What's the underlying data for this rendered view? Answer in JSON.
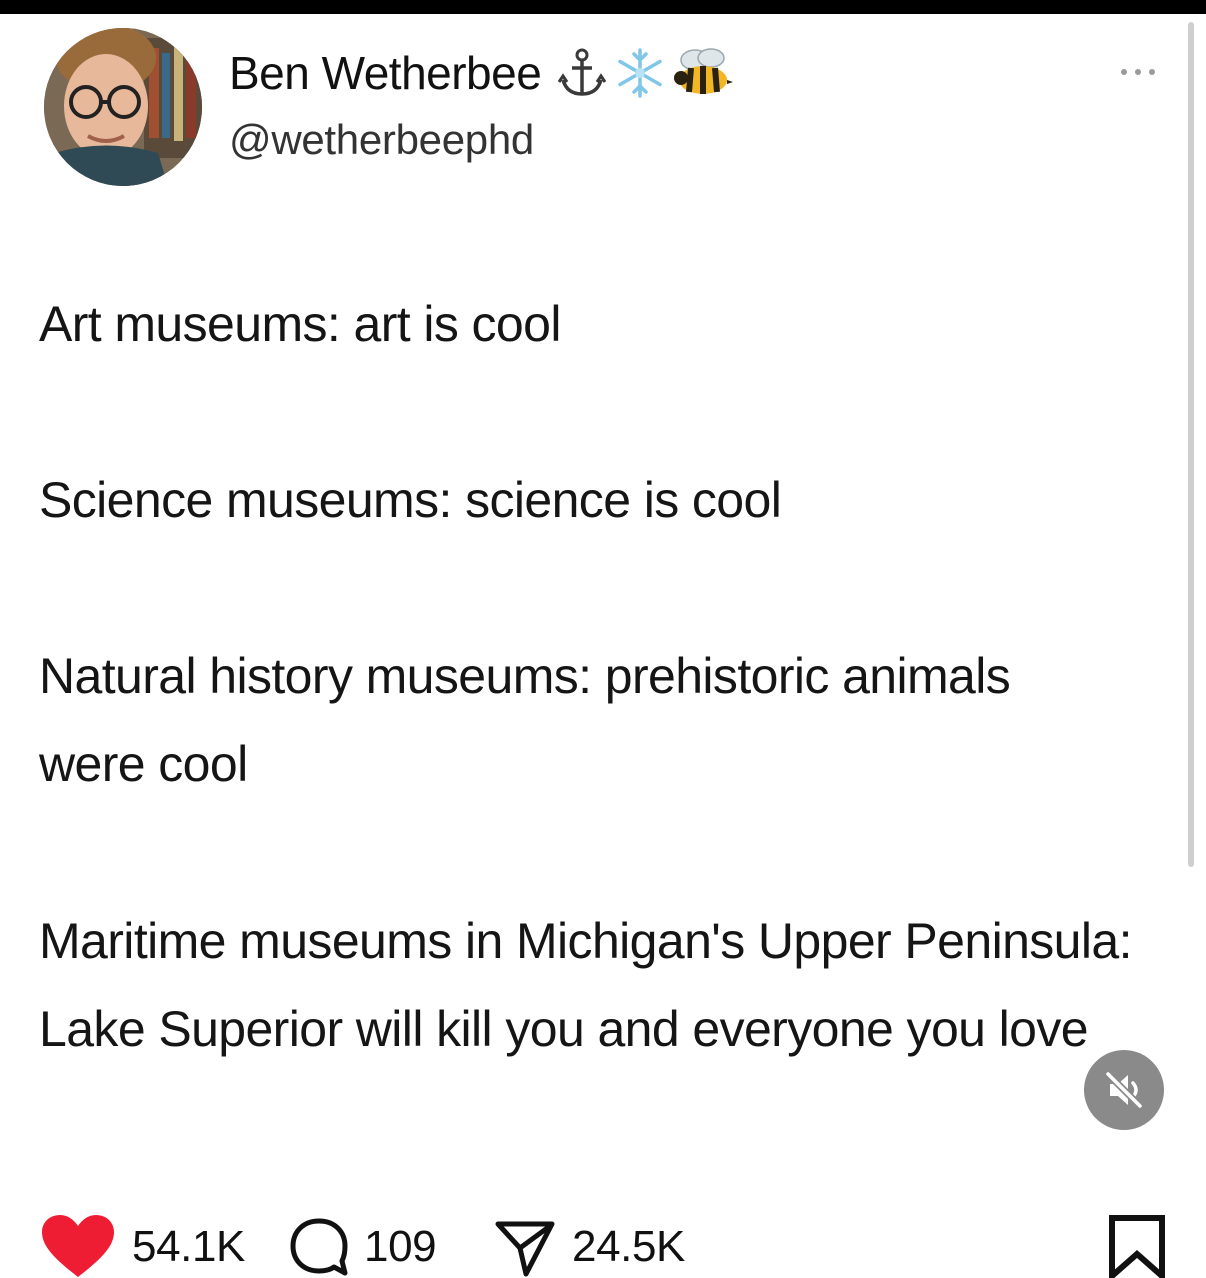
{
  "post": {
    "author": {
      "display_name": "Ben Wetherbee",
      "handle": "@wetherbeephd",
      "badges": [
        "anchor-emoji",
        "snowflake-emoji",
        "bee-emoji"
      ]
    },
    "paragraphs": [
      "Art museums: art is cool",
      "Science museums: science is cool",
      "Natural history museums: prehistoric animals were cool",
      "Maritime museums in Michigan's Upper Peninsula: Lake Superior will kill you and everyone you love"
    ]
  },
  "actions": {
    "likes": "54.1K",
    "comments": "109",
    "shares": "24.5K"
  },
  "icons": {
    "like": "heart-icon",
    "comment": "comment-bubble-icon",
    "share": "send-icon",
    "bookmark": "bookmark-icon",
    "mute": "muted-speaker-icon",
    "more": "more-dots-icon"
  },
  "colors": {
    "heart": "#ee1d33",
    "mute_button": "#8a8a8a",
    "text": "#151515"
  }
}
